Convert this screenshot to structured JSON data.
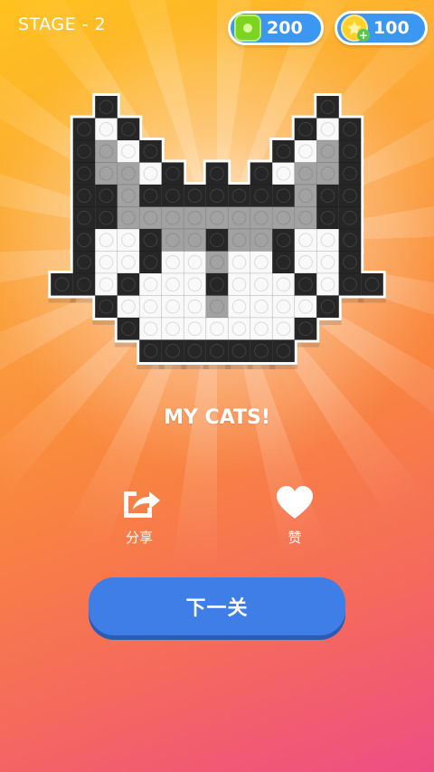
{
  "header": {
    "stage_label": "STAGE - 2",
    "gems": "200",
    "coins": "100"
  },
  "artwork": {
    "title": "MY CATS!",
    "palette": {
      "B": "#262626",
      "G": "#a2a2a2",
      "W": "#f9f9f9"
    },
    "rows": [
      ".B.........B.",
      "BWB.......BWB",
      "BGWB.....BWGB",
      "BGGWB.B.BWGGB",
      "BBGBBBBBBBGBB",
      "BBGGGGGGGGGBB",
      "BWWBGGBGGBWWB",
      "BWWBWWGWWBWWB",
      "BWBWWWBWWWBWB",
      ".BWWWWGWWWWB.",
      "..BWWWWWWWB..",
      "...BBBBBBB..."
    ],
    "ear_rows": [
      "B...............B"
    ]
  },
  "actions": {
    "share_label": "分享",
    "like_label": "赞"
  },
  "next_button_label": "下一关",
  "colors": {
    "accent_blue": "#3f7ee6",
    "pill_blue": "#3b97f1"
  }
}
